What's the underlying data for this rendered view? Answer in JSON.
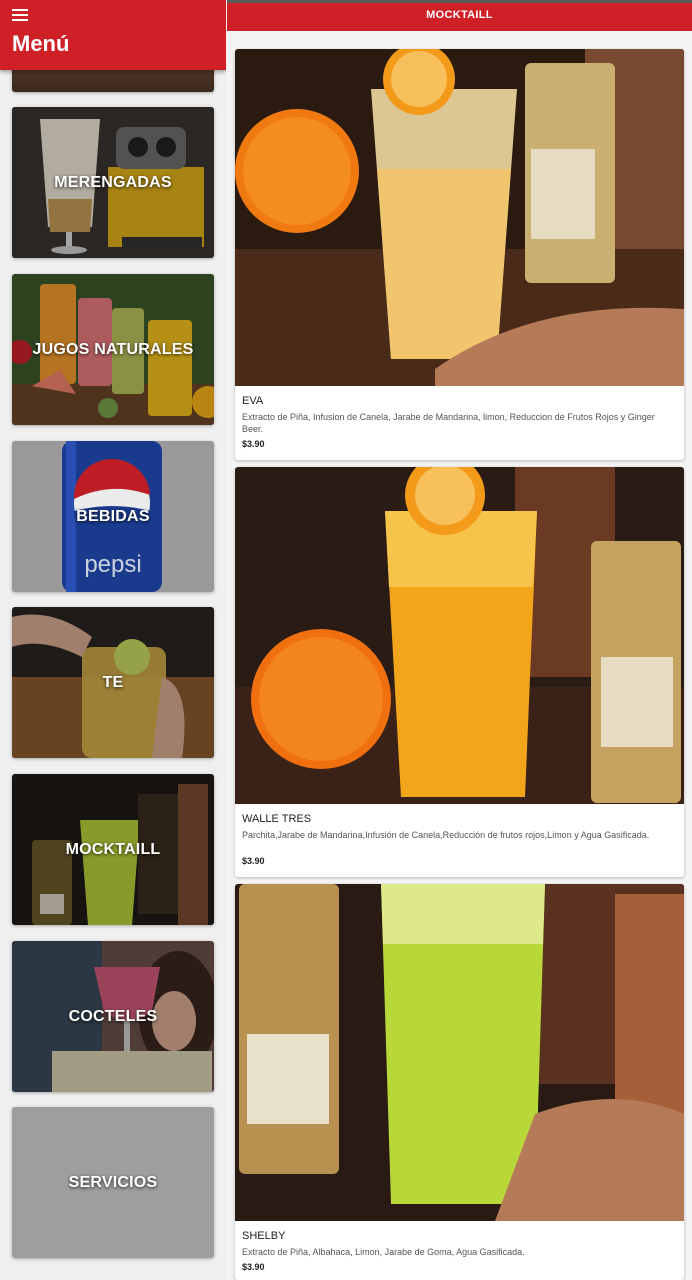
{
  "sidebar": {
    "title": "Menú",
    "categories": [
      {
        "label": "MERENGADAS"
      },
      {
        "label": "JUGOS NATURALES"
      },
      {
        "label": "BEBIDAS"
      },
      {
        "label": "TE"
      },
      {
        "label": "MOCKTAILL"
      },
      {
        "label": "COCTELES"
      },
      {
        "label": "SERVICIOS"
      }
    ],
    "pepsi_logo_text": "pepsi"
  },
  "header": {
    "title": "MOCKTAILL"
  },
  "products": [
    {
      "name": "EVA",
      "description": "Extracto de Piña, Infusion de Canela, Jarabe de Mandarina, limon, Reduccion de Frutos Rojos y Ginger Beer.",
      "price": "$3.90"
    },
    {
      "name": "WALLE TRES",
      "description": "Parchita,Jarabe de Mandarina,Infusión de Canela,Reducción de frutos rojos,Limon y Agua Gasificada.",
      "price": "$3.90"
    },
    {
      "name": "SHELBY",
      "description": "Extracto de Piña, Albahaca, Limon, Jarabe de Goma, Agua Gasificada.",
      "price": "$3.90"
    }
  ],
  "colors": {
    "brand_red": "#cf2027",
    "servicios_gray": "#9e9e9e"
  }
}
